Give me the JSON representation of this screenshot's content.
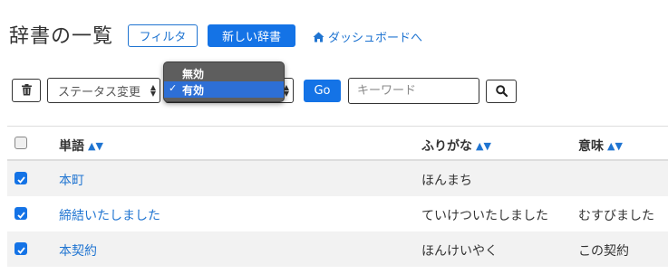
{
  "header": {
    "title": "辞書の一覧",
    "filter_button": "フィルタ",
    "new_button": "新しい辞書",
    "dashboard_link": "ダッシュボードへ"
  },
  "toolbar": {
    "status_select_value": "ステータス変更",
    "go_button": "Go",
    "keyword_placeholder": "キーワード"
  },
  "dropdown": {
    "options": [
      {
        "label": "無効",
        "selected": false
      },
      {
        "label": "有効",
        "selected": true
      }
    ],
    "check_mark": "✓"
  },
  "table": {
    "columns": [
      "単語",
      "ふりがな",
      "意味"
    ],
    "sort_indicator": "▲▼",
    "rows": [
      {
        "word": "本町",
        "furigana": "ほんまち",
        "meaning": "",
        "checked": true
      },
      {
        "word": "締結いたしました",
        "furigana": "ていけついたしました",
        "meaning": "むすびました",
        "checked": true
      },
      {
        "word": "本契約",
        "furigana": "ほんけいやく",
        "meaning": "この契約",
        "checked": true
      }
    ]
  },
  "colors": {
    "primary": "#1473e6",
    "link": "#1f74d1",
    "dropdown_bg": "#5e5e5e",
    "dropdown_selected": "#2d6fd6",
    "row_stripe": "#f2f2f2"
  }
}
